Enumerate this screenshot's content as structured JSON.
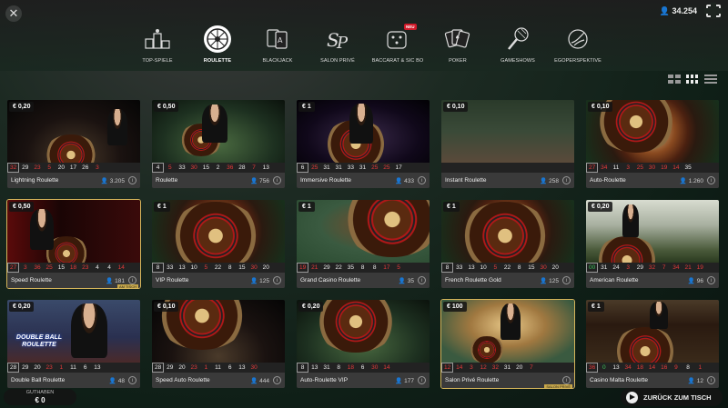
{
  "header": {
    "close_symbol": "✕",
    "balance": "34.254",
    "balance_icon": "person-icon",
    "nav": [
      {
        "label": "TOP-SPIELE",
        "icon": "podium-icon"
      },
      {
        "label": "ROULETTE",
        "icon": "roulette-wheel-icon",
        "active": true
      },
      {
        "label": "BLACKJACK",
        "icon": "cards-icon"
      },
      {
        "label": "SALON PRIVÉ",
        "icon": "sp-monogram-icon"
      },
      {
        "label": "BACCARAT & SIC BO",
        "icon": "dice-icon",
        "badge": "NEU"
      },
      {
        "label": "POKER",
        "icon": "poker-cards-icon"
      },
      {
        "label": "GAMESHOWS",
        "icon": "microphone-icon"
      },
      {
        "label": "EGOPERSPEKTIVE",
        "icon": "first-person-icon"
      }
    ]
  },
  "tiles": [
    {
      "title": "Lightning Roulette",
      "bet": "€ 0,20",
      "players": "3.205",
      "results": [
        "32",
        "29",
        "23",
        "5",
        "20",
        "17",
        "26",
        "3"
      ],
      "colors": [
        "r",
        "b",
        "r",
        "r",
        "b",
        "b",
        "b",
        "r"
      ]
    },
    {
      "title": "Roulette",
      "bet": "€ 0,50",
      "players": "756",
      "results": [
        "4",
        "5",
        "33",
        "30",
        "15",
        "2",
        "36",
        "28",
        "7",
        "13"
      ],
      "colors": [
        "b",
        "r",
        "b",
        "r",
        "b",
        "b",
        "r",
        "b",
        "r",
        "b"
      ]
    },
    {
      "title": "Immersive Roulette",
      "bet": "€ 1",
      "players": "433",
      "results": [
        "6",
        "25",
        "31",
        "31",
        "33",
        "31",
        "25",
        "25",
        "17"
      ],
      "colors": [
        "b",
        "r",
        "b",
        "b",
        "b",
        "b",
        "r",
        "r",
        "b"
      ]
    },
    {
      "title": "Instant Roulette",
      "bet": "€ 0,10",
      "players": "258",
      "results": [],
      "colors": []
    },
    {
      "title": "Auto-Roulette",
      "bet": "€ 0,10",
      "players": "1.260",
      "results": [
        "27",
        "34",
        "11",
        "3",
        "25",
        "30",
        "19",
        "14",
        "35"
      ],
      "colors": [
        "r",
        "r",
        "b",
        "r",
        "r",
        "r",
        "r",
        "r",
        "b"
      ]
    },
    {
      "title": "Speed Roulette",
      "bet": "€ 0,50",
      "players": "181",
      "results": [
        "27",
        "3",
        "36",
        "25",
        "15",
        "18",
        "23",
        "4",
        "4",
        "14"
      ],
      "colors": [
        "r",
        "r",
        "r",
        "r",
        "b",
        "r",
        "r",
        "b",
        "b",
        "r"
      ],
      "highlight": true,
      "tag": "AM TISCH"
    },
    {
      "title": "VIP Roulette",
      "bet": "€ 1",
      "players": "125",
      "results": [
        "8",
        "33",
        "13",
        "10",
        "5",
        "22",
        "8",
        "15",
        "30",
        "20"
      ],
      "colors": [
        "b",
        "b",
        "b",
        "b",
        "r",
        "b",
        "b",
        "b",
        "r",
        "b"
      ]
    },
    {
      "title": "Grand Casino Roulette",
      "bet": "€ 1",
      "players": "35",
      "results": [
        "19",
        "21",
        "29",
        "22",
        "35",
        "8",
        "8",
        "17",
        "5"
      ],
      "colors": [
        "r",
        "r",
        "b",
        "b",
        "b",
        "b",
        "b",
        "r",
        "r"
      ]
    },
    {
      "title": "French Roulette Gold",
      "bet": "€ 1",
      "players": "125",
      "results": [
        "8",
        "33",
        "13",
        "10",
        "5",
        "22",
        "8",
        "15",
        "30",
        "20"
      ],
      "colors": [
        "b",
        "b",
        "b",
        "b",
        "r",
        "b",
        "b",
        "b",
        "r",
        "b"
      ]
    },
    {
      "title": "American Roulette",
      "bet": "€ 0,20",
      "players": "96",
      "results": [
        "00",
        "31",
        "24",
        "3",
        "29",
        "32",
        "7",
        "34",
        "21",
        "19"
      ],
      "colors": [
        "g",
        "b",
        "b",
        "r",
        "b",
        "r",
        "r",
        "r",
        "r",
        "r"
      ]
    },
    {
      "title": "Double Ball Roulette",
      "bet": "€ 0,20",
      "players": "48",
      "results": [
        "28",
        "29",
        "20",
        "23",
        "1",
        "11",
        "6",
        "13"
      ],
      "colors": [
        "b",
        "b",
        "b",
        "r",
        "r",
        "b",
        "b",
        "b"
      ],
      "overlay": "DOUBLE BALL ROULETTE"
    },
    {
      "title": "Speed Auto Roulette",
      "bet": "€ 0,10",
      "players": "444",
      "results": [
        "28",
        "29",
        "20",
        "23",
        "1",
        "11",
        "6",
        "13",
        "30"
      ],
      "colors": [
        "b",
        "b",
        "b",
        "r",
        "r",
        "b",
        "b",
        "b",
        "r"
      ]
    },
    {
      "title": "Auto-Roulette VIP",
      "bet": "€ 0,20",
      "players": "177",
      "results": [
        "8",
        "13",
        "31",
        "8",
        "18",
        "6",
        "30",
        "14"
      ],
      "colors": [
        "b",
        "b",
        "b",
        "b",
        "r",
        "b",
        "r",
        "r"
      ]
    },
    {
      "title": "Salon Privé Roulette",
      "bet": "€ 100",
      "players": "",
      "results": [
        "12",
        "14",
        "3",
        "12",
        "32",
        "31",
        "20",
        "7"
      ],
      "colors": [
        "r",
        "r",
        "r",
        "r",
        "r",
        "b",
        "b",
        "r"
      ],
      "highlight": true,
      "tag": "SALON PRIVÉ"
    },
    {
      "title": "Casino Malta Roulette",
      "bet": "€ 1",
      "players": "12",
      "results": [
        "36",
        "0",
        "13",
        "34",
        "18",
        "14",
        "16",
        "9",
        "8",
        "1"
      ],
      "colors": [
        "r",
        "g",
        "b",
        "r",
        "r",
        "r",
        "r",
        "r",
        "b",
        "r"
      ]
    }
  ],
  "footer": {
    "balance_label": "GUTHABEN",
    "balance_value": "€ 0",
    "back_label": "ZURÜCK ZUM TISCH"
  }
}
